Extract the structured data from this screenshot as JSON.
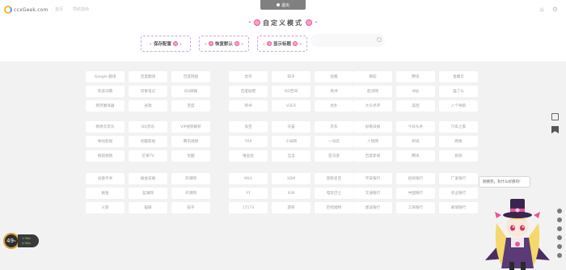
{
  "header": {
    "logo_text": "ccxGeek.com",
    "nav": [
      "首页",
      "导航指南"
    ],
    "exit_label": "退出",
    "title": "自定义模式"
  },
  "controls": {
    "save_label": "保存配置",
    "reset_label": "恢复默认",
    "show_title_label": "显示标题",
    "search_placeholder": ""
  },
  "groups": [
    {
      "col1": [
        "Google 翻译",
        "百度翻译",
        "百度网盘",
        "有道词典",
        "印象笔记",
        "QQ邮箱",
        "网页翻译器",
        "谷歌",
        "百度"
      ],
      "col2": [
        "虎牙",
        "知乎",
        "豆瓣",
        "百度贴吧",
        "QQ空间",
        "简书",
        "简书",
        "V2EX",
        "虎扑"
      ],
      "col3": [
        "微软",
        "腾讯",
        "金螺云",
        "起点网",
        "B站",
        "猫了么",
        "大众点评",
        "美团",
        "八个导航"
      ]
    },
    {
      "col1": [
        "网易云音乐",
        "QQ音乐",
        "VIP视频解析",
        "咪咕影视",
        "优酷影视",
        "腾讯视频",
        "搜狐视频",
        "芒果TV",
        "优酷"
      ],
      "col2": [
        "淘宝",
        "天猫",
        "京东",
        "YXX",
        "小米网",
        "一号店",
        "唯品会",
        "当当",
        "亚马逊"
      ],
      "col3": [
        "好看日报",
        "今日头条",
        "汽车之家",
        "人民网",
        "新浪",
        "网易",
        "百度新闻",
        "腾讯",
        "新浪"
      ]
    },
    {
      "col1": [
        "谷歌学术",
        "掘金前端",
        "开源网",
        "掘金",
        "蓝湖网",
        "开源网",
        "火影",
        "猫眼",
        "知乎"
      ],
      "col2": [
        "NSA",
        "3DM",
        "游民星空",
        "YY",
        "IGN",
        "电玩巴士",
        "17173",
        "游侠",
        "巴哈姆特"
      ],
      "col3": [
        "平安银行",
        "招商银行",
        "广发银行",
        "交通银行",
        "中国银行",
        "农业银行",
        "建设银行",
        "工商银行",
        "邮储银行"
      ]
    }
  ],
  "speed_widget": {
    "value": "49",
    "unit": "%",
    "up": "1.3K/s",
    "down": "4.5K/s"
  },
  "mascot": {
    "bubble_text": "刚摸完，有什么好摸的!"
  }
}
